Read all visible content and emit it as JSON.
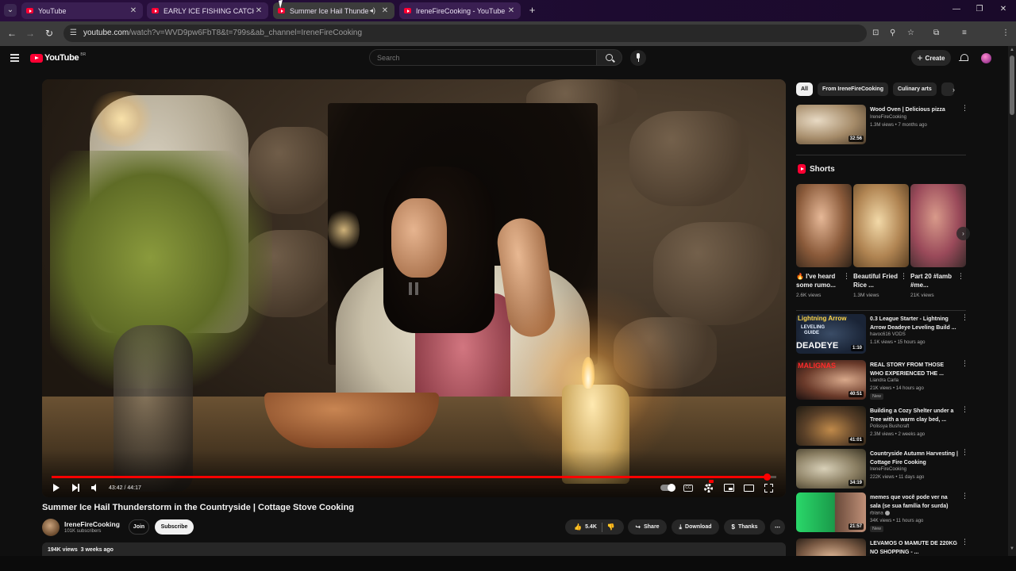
{
  "browser": {
    "tabs": [
      {
        "title": "YouTube"
      },
      {
        "title": "EARLY ICE FISHING CATCH AND"
      },
      {
        "title": "Summer Ice Hail Thunderst"
      },
      {
        "title": "IreneFireCooking - YouTube"
      }
    ],
    "new_tab": "+",
    "url": "youtube.com",
    "url_rest": "/watch?v=WVD9pw6FbT8&t=799s&ab_channel=IreneFireCooking"
  },
  "header": {
    "logo": "YouTube",
    "country": "BR",
    "search_placeholder": "Search",
    "create_label": "Create"
  },
  "player": {
    "current_time": "43:42",
    "duration": "44:17",
    "progress_fraction": 0.987
  },
  "video": {
    "title": "Summer Ice Hail Thunderstorm in the Countryside | Cottage Stove Cooking",
    "channel": "IreneFireCooking",
    "subscribers": "101K subscribers",
    "join_label": "Join",
    "subscribe_label": "Subscribe",
    "likes": "5.4K",
    "share_label": "Share",
    "download_label": "Download",
    "thanks_label": "Thanks",
    "views": "194K views",
    "age": "3 weeks ago"
  },
  "chips": [
    "All",
    "From IreneFireCooking",
    "Culinary arts"
  ],
  "recommended_top": {
    "title": "Wood Oven | Delicious pizza",
    "channel": "IreneFireCooking",
    "meta": "1.3M views • 7 months ago",
    "duration": "32:56"
  },
  "shorts": {
    "heading": "Shorts",
    "items": [
      {
        "title": "🔥 I've heard some rumo...",
        "views": "2.6K views"
      },
      {
        "title": "Beautiful Fried Rice ...",
        "views": "1.3M views"
      },
      {
        "title": "Part 20 #lamb #me...",
        "views": "21K views"
      }
    ]
  },
  "recommended": [
    {
      "title": "0.3 League Starter - Lightning Arrow Deadeye Leveling Build ...",
      "channel": "havoc616 VODS",
      "meta": "1.1K views • 15 hours ago",
      "duration": "1:10",
      "badge": ""
    },
    {
      "title": "REAL STORY FROM THOSE WHO EXPERIENCED THE ...",
      "channel": "Liandra Carla",
      "meta": "21K views • 14 hours ago",
      "duration": "40:51",
      "badge": "New"
    },
    {
      "title": "Building a Cozy Shelter under a Tree with a warm clay bed, ...",
      "channel": "Polissya Bushcraft",
      "meta": "2.3M views • 2 weeks ago",
      "duration": "41:01",
      "badge": ""
    },
    {
      "title": "Countryside Autumn Harvesting | Cottage Fire Cooking",
      "channel": "IreneFireCooking",
      "meta": "222K views • 11 days ago",
      "duration": "34:19",
      "badge": ""
    },
    {
      "title": "memes que você pode ver na sala (se sua família for surda)",
      "channel": "rbiana",
      "meta": "34K views • 11 hours ago",
      "duration": "21:57",
      "badge": "New"
    },
    {
      "title": "LEVAMOS O MAMUTE DE 220KG NO SHOPPING - ...",
      "channel": "",
      "meta": "",
      "duration": "",
      "badge": ""
    }
  ],
  "thumb_texts": {
    "r0_line1": "Lightning Arrow",
    "r0_line2": "LEVELING",
    "r0_line3": "GUIDE",
    "r0_line4": "DEADEYE",
    "r1_line1": "MALIGNAS"
  },
  "colors": {
    "accent": "#ff0033",
    "progress": "#ff0000",
    "background": "#0f0f0f"
  }
}
